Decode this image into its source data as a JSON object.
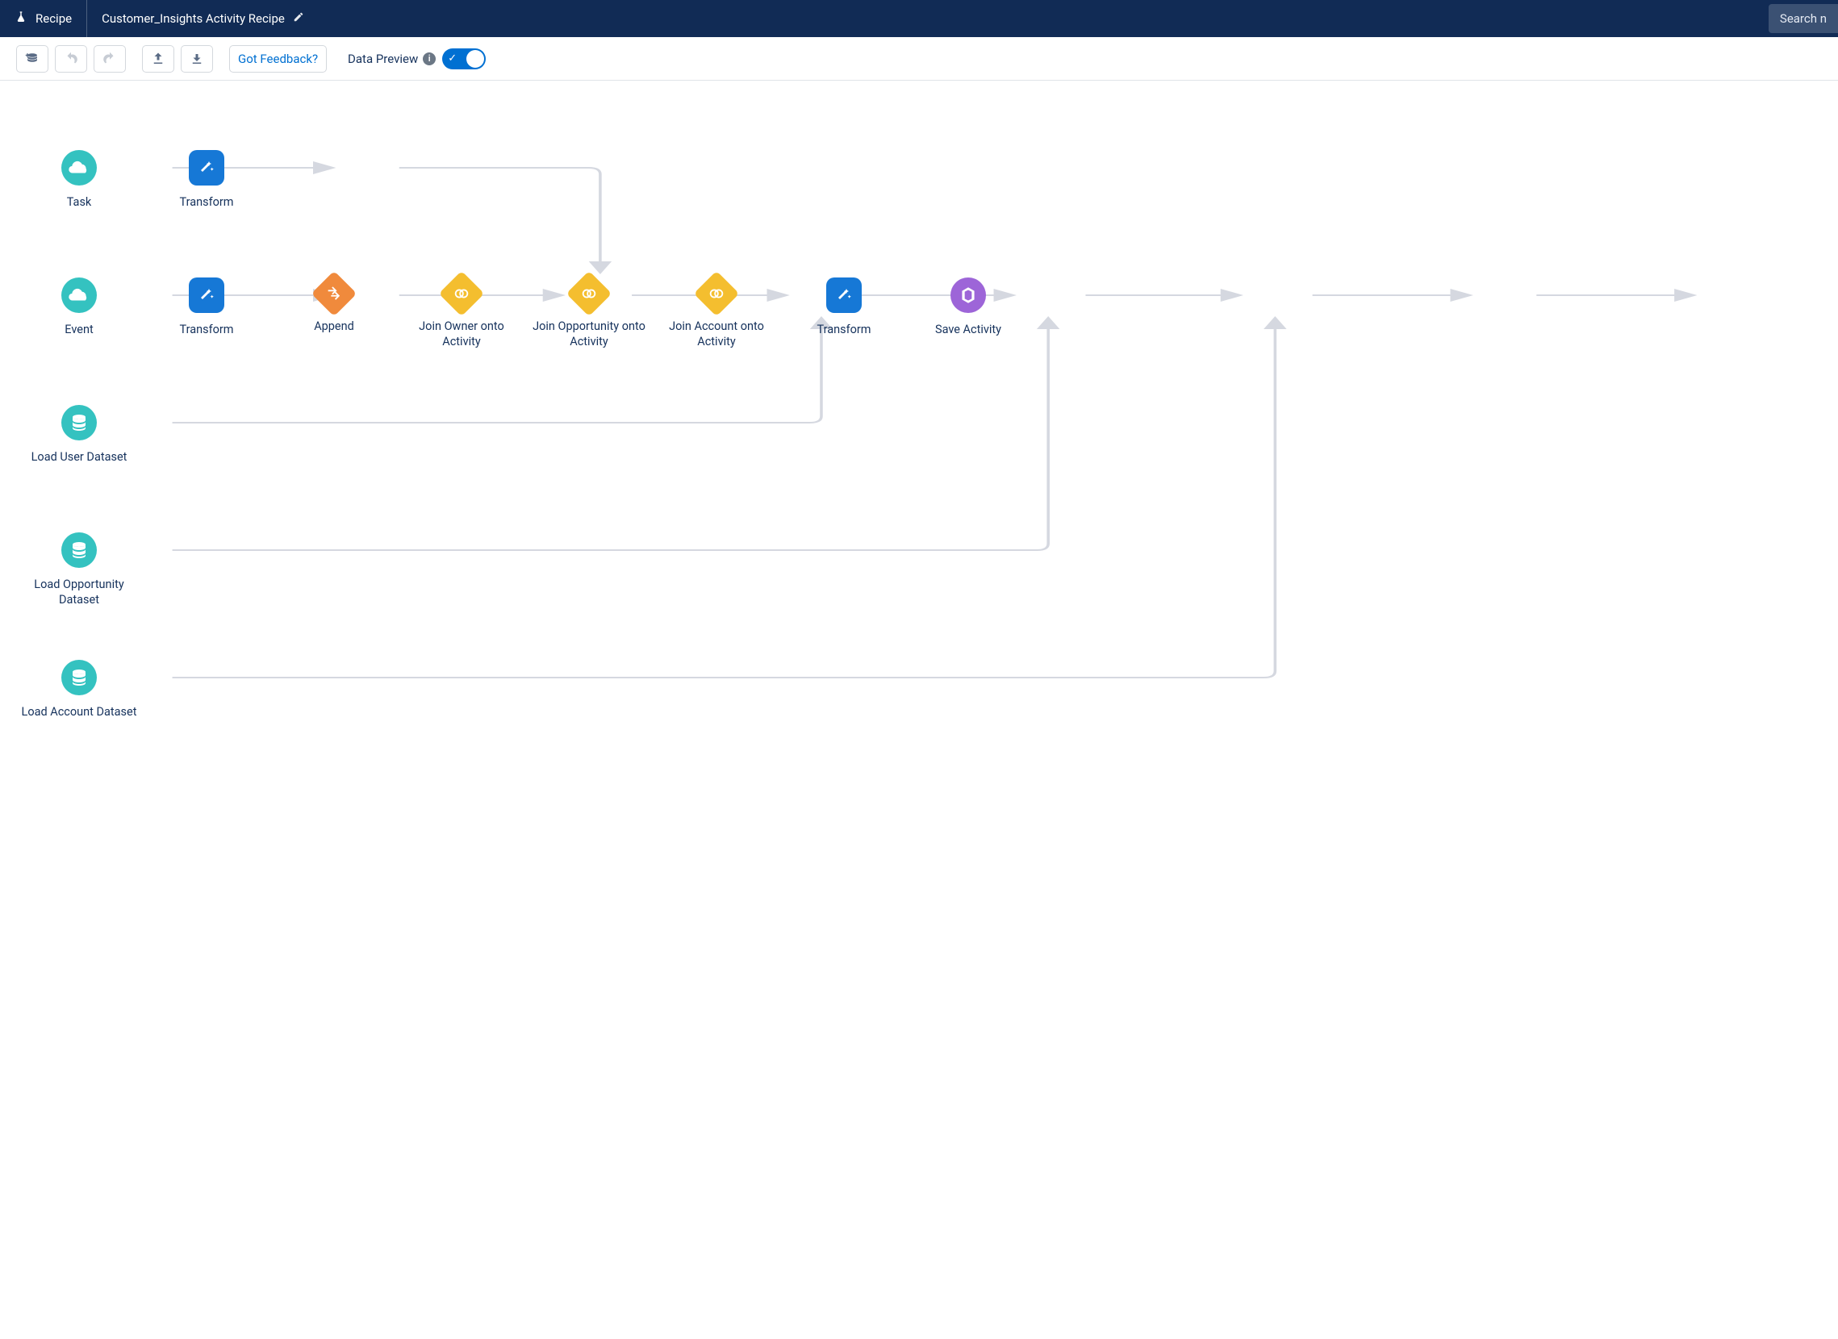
{
  "header": {
    "type_label": "Recipe",
    "title": "Customer_Insights Activity Recipe",
    "search_placeholder": "Search n"
  },
  "toolbar": {
    "feedback_label": "Got Feedback?",
    "preview_label": "Data Preview"
  },
  "nodes": {
    "task": {
      "label": "Task"
    },
    "event": {
      "label": "Event"
    },
    "load_user": {
      "label": "Load User Dataset"
    },
    "load_opportunity": {
      "label": "Load Opportunity Dataset"
    },
    "load_account": {
      "label": "Load Account Dataset"
    },
    "transform_task": {
      "label": "Transform"
    },
    "transform_event": {
      "label": "Transform"
    },
    "append": {
      "label": "Append"
    },
    "join_owner": {
      "label": "Join Owner onto Activity"
    },
    "join_opportunity": {
      "label": "Join Opportunity onto Activity"
    },
    "join_account": {
      "label": "Join Account onto Activity"
    },
    "transform_final": {
      "label": "Transform"
    },
    "save": {
      "label": "Save Activity"
    }
  }
}
